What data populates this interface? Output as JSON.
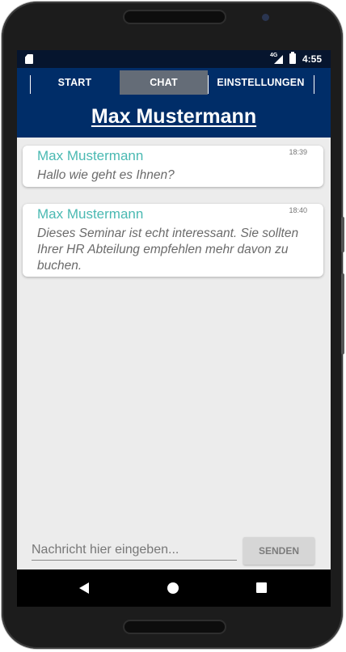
{
  "status_bar": {
    "network": "4G",
    "time": "4:55",
    "icons": [
      "sd-card-icon",
      "signal-icon",
      "battery-icon"
    ]
  },
  "tabs": [
    {
      "label": "START",
      "active": false
    },
    {
      "label": "CHAT",
      "active": true
    },
    {
      "label": "EINSTELLUNGEN",
      "active": false
    }
  ],
  "contact_name": "Max Mustermann",
  "messages": [
    {
      "sender": "Max Mustermann",
      "time": "18:39",
      "text": "Hallo wie geht es Ihnen?"
    },
    {
      "sender": "Max Mustermann",
      "time": "18:40",
      "text": "Dieses Seminar ist echt interessant. Sie sollten Ihrer HR Abteilung empfehlen mehr davon zu buchen."
    }
  ],
  "composer": {
    "placeholder": "Nachricht hier eingeben...",
    "value": "",
    "send_label": "SENDEN"
  },
  "nav_bar": {
    "icons": [
      "back-icon",
      "home-icon",
      "recent-apps-icon"
    ]
  },
  "colors": {
    "appbar": "#002d68",
    "active_tab": "#646c77",
    "sender_name": "#4ab9b2",
    "background": "#ececec"
  }
}
